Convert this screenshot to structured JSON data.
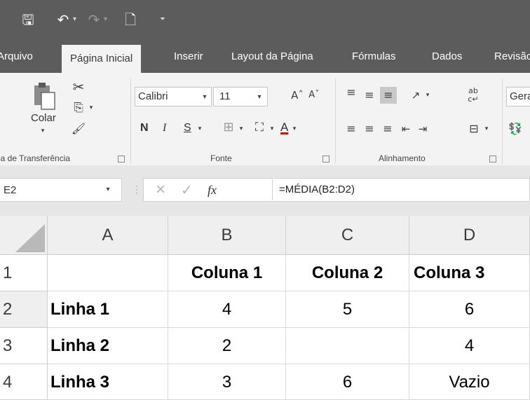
{
  "quick_access": {
    "save_icon": "save-icon",
    "undo_icon": "undo-icon",
    "redo_icon": "redo-icon",
    "print_preview_icon": "print-preview-icon",
    "customize_icon": "customize-qat-icon"
  },
  "tabs": [
    {
      "label": "Arquivo"
    },
    {
      "label": "Página Inicial"
    },
    {
      "label": "Inserir"
    },
    {
      "label": "Layout da Página"
    },
    {
      "label": "Fórmulas"
    },
    {
      "label": "Dados"
    },
    {
      "label": "Revisão"
    }
  ],
  "ribbon": {
    "clipboard": {
      "paste_label": "Colar",
      "group_label": "Área de Transferência"
    },
    "font": {
      "name": "Calibri",
      "size": "11",
      "bold": "N",
      "italic": "I",
      "underline": "S",
      "group_label": "Fonte",
      "font_color": "#c00000"
    },
    "alignment": {
      "group_label": "Alinhamento"
    },
    "number": {
      "format": "Geral"
    }
  },
  "formula_bar": {
    "name_box": "E2",
    "cancel": "×",
    "enter": "✓",
    "fx": "fx",
    "formula": "=MÉDIA(B2:D2)"
  },
  "grid": {
    "columns": [
      "A",
      "B",
      "C",
      "D"
    ],
    "rows": [
      {
        "num": "1",
        "cells": [
          "",
          "Coluna 1",
          "Coluna 2",
          "Coluna 3"
        ]
      },
      {
        "num": "2",
        "cells": [
          "Linha 1",
          "4",
          "5",
          "6"
        ]
      },
      {
        "num": "3",
        "cells": [
          "Linha 2",
          "2",
          "",
          "4"
        ]
      },
      {
        "num": "4",
        "cells": [
          "Linha 3",
          "3",
          "6",
          "Vazio"
        ]
      }
    ]
  }
}
